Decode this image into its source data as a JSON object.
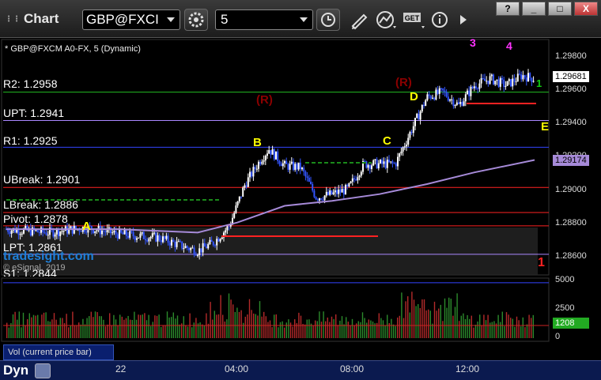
{
  "toolbar": {
    "title": "Chart",
    "symbol": "GBP@FXCI",
    "interval": "5",
    "window_buttons": [
      "?",
      "_",
      "□",
      "X"
    ]
  },
  "chart": {
    "study_title": "* GBP@FXCM A0-FX, 5 (Dynamic)",
    "levels": [
      {
        "label": "R2: 1.2958",
        "color": "#22bb22"
      },
      {
        "label": "UPT: 1.2941",
        "color": "#aa88ff"
      },
      {
        "label": "R1: 1.2925",
        "color": "#3344ff"
      },
      {
        "label": "UBreak: 1.2901",
        "color": "#ff2222"
      },
      {
        "label": "LBreak: 1.2886",
        "color": "#ff2222"
      },
      {
        "label": "Pivot: 1.2878",
        "color": "#ff2222"
      },
      {
        "label": "LPT: 1.2861",
        "color": "#aa88ff"
      },
      {
        "label": "S1: 1.2844",
        "color": "#3344ff"
      }
    ],
    "watermark": "tradesight.com",
    "copyright": "© eSignal, 2019",
    "price_ticks": [
      "1.29800",
      "1.29600",
      "1.29400",
      "1.29200",
      "1.29000",
      "1.28800",
      "1.28600"
    ],
    "last_price": "1.29681",
    "ma_value": "1.29174",
    "annotations": [
      "A",
      "B",
      "C",
      "D",
      "E",
      "(R)",
      "(R)",
      "1",
      "1",
      "3",
      "4"
    ],
    "volume_ticks": [
      "5000",
      "2500",
      "0"
    ],
    "volume_value": "1208",
    "volume_label": "Vol (current price bar)"
  },
  "chart_data": {
    "type": "bar",
    "title": "* GBP@FXCM A0-FX, 5 (Dynamic)",
    "x": [
      "22",
      "04:00",
      "08:00",
      "12:00"
    ],
    "ylim": [
      1.285,
      1.299
    ],
    "last": 1.29681,
    "moving_average_last": 1.29174,
    "pivot_levels": {
      "R2": 1.2958,
      "UPT": 1.2941,
      "R1": 1.2925,
      "UBreak": 1.2901,
      "LBreak": 1.2886,
      "Pivot": 1.2878,
      "LPT": 1.2861,
      "S1": 1.2844
    },
    "volume_ylim": [
      0,
      5000
    ],
    "volume_last": 1208
  },
  "bottom": {
    "mode": "Dyn",
    "time_labels": [
      "22",
      "04:00",
      "08:00",
      "12:00"
    ]
  }
}
